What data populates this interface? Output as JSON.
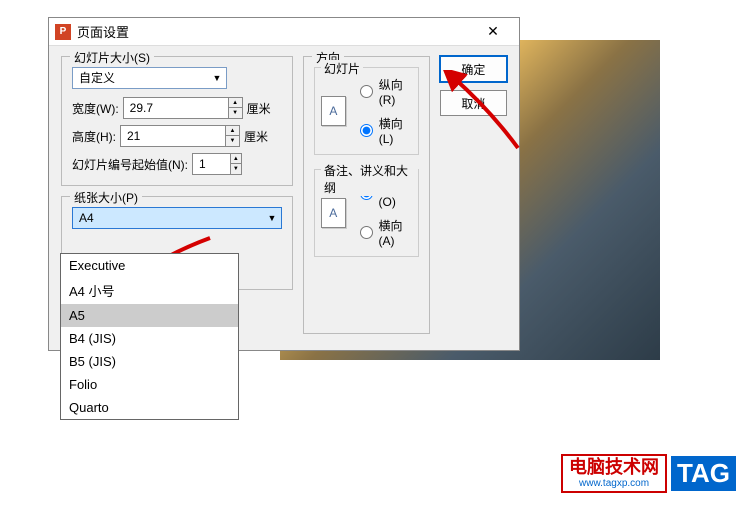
{
  "dialog": {
    "title": "页面设置",
    "close": "✕"
  },
  "slideSize": {
    "label": "幻灯片大小(S)",
    "value": "自定义",
    "widthLabel": "宽度(W):",
    "widthValue": "29.7",
    "heightLabel": "高度(H):",
    "heightValue": "21",
    "unit": "厘米",
    "startNumLabel": "幻灯片编号起始值(N):",
    "startNumValue": "1"
  },
  "paperSize": {
    "label": "纸张大小(P)",
    "value": "A4",
    "options": [
      "Executive",
      "A4 小号",
      "A5",
      "B4 (JIS)",
      "B5 (JIS)",
      "Folio",
      "Quarto"
    ]
  },
  "orientation": {
    "label": "方向",
    "slideGroup": "幻灯片",
    "notesGroup": "备注、讲义和大纲",
    "portrait": "纵向(R)",
    "landscape": "横向(L)",
    "portraitO": "纵向(O)",
    "landscapeA": "横向(A)",
    "iconLetter": "A"
  },
  "buttons": {
    "ok": "确定",
    "cancel": "取消"
  },
  "watermark": {
    "text": "电脑技术网",
    "url": "www.tagxp.com",
    "tag": "TAG"
  }
}
